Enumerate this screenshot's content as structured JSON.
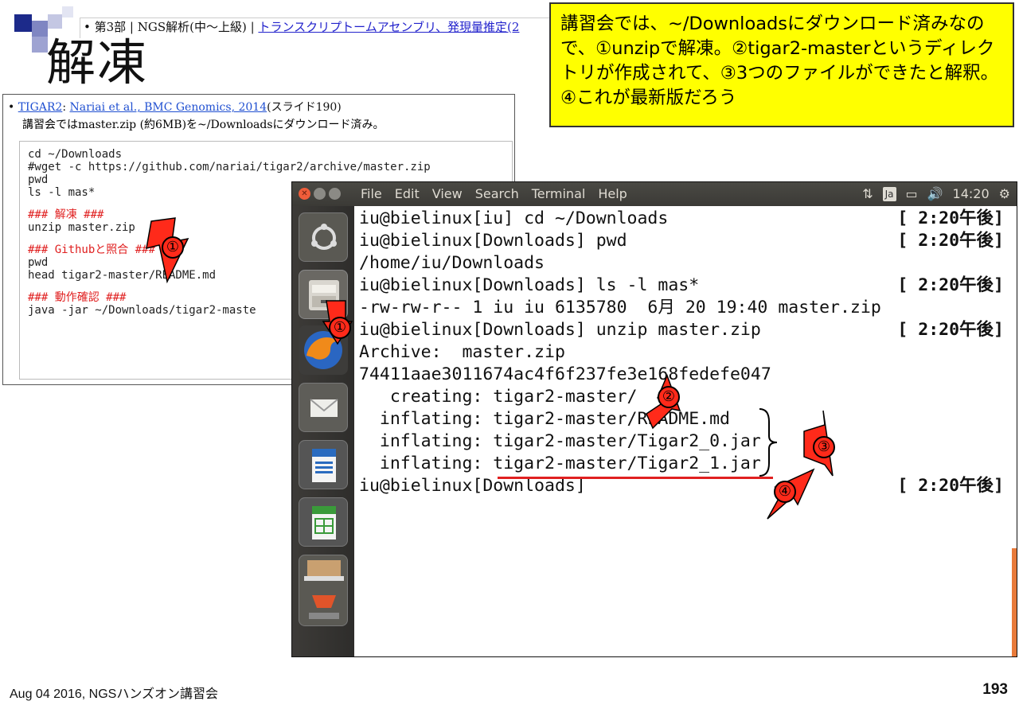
{
  "slide": {
    "breadcrumb_prefix": "• 第3部 | NGS解析(中～上級) | ",
    "breadcrumb_link": "トランスクリプトームアセンブリ、発現量推定(2",
    "title": "解凍",
    "footer": "Aug 04 2016, NGSハンズオン講習会",
    "page_number": "193"
  },
  "callout": {
    "text": "講習会では、~/Downloadsにダウンロード済みなので、①unzipで解凍。②tigar2-masterというディレクトリが作成されて、③3つのファイルができたと解釈。④これが最新版だろう"
  },
  "doc": {
    "bullet_link1": "TIGAR2",
    "bullet_sep": ": ",
    "bullet_link2": "Nariai et al., BMC Genomics, 2014",
    "bullet_tail": "(スライド190)",
    "note": "講習会ではmaster.zip (約6MB)を~/Downloadsにダウンロード済み。",
    "code": [
      "cd ~/Downloads",
      "#wget -c https://github.com/nariai/tigar2/archive/master.zip",
      "pwd",
      "ls -l mas*",
      "### 解凍 ###",
      "unzip master.zip",
      "### Githubと照合 ###",
      "pwd",
      "head tigar2-master/README.md",
      "### 動作確認 ###",
      "java -jar ~/Downloads/tigar2-maste"
    ]
  },
  "terminal": {
    "menu": [
      "File",
      "Edit",
      "View",
      "Search",
      "Terminal",
      "Help"
    ],
    "tray": {
      "lang": "Ja",
      "time": "14:20"
    },
    "lines": [
      {
        "text": "iu@bielinux[iu] cd ~/Downloads",
        "stamp": "[ 2:20午後]"
      },
      {
        "text": "iu@bielinux[Downloads] pwd",
        "stamp": "[ 2:20午後]"
      },
      {
        "text": "/home/iu/Downloads",
        "stamp": ""
      },
      {
        "text": "iu@bielinux[Downloads] ls -l mas*",
        "stamp": "[ 2:20午後]"
      },
      {
        "text": "-rw-rw-r-- 1 iu iu 6135780  6月 20 19:40 master.zip",
        "stamp": ""
      },
      {
        "text": "iu@bielinux[Downloads] unzip master.zip",
        "stamp": "[ 2:20午後]"
      },
      {
        "text": "Archive:  master.zip",
        "stamp": ""
      },
      {
        "text": "74411aae3011674ac4f6f237fe3e168fedefe047",
        "stamp": ""
      },
      {
        "text": "   creating: tigar2-master/",
        "stamp": ""
      },
      {
        "text": "  inflating: tigar2-master/README.md",
        "stamp": ""
      },
      {
        "text": "  inflating: tigar2-master/Tigar2_0.jar",
        "stamp": ""
      },
      {
        "text": "  inflating: tigar2-master/Tigar2_1.jar",
        "stamp": ""
      },
      {
        "text": "iu@bielinux[Downloads]",
        "stamp": "[ 2:20午後]"
      }
    ]
  },
  "markers": [
    "①",
    "①",
    "②",
    "③",
    "④"
  ],
  "colors": {
    "callout_bg": "#ffff00",
    "marker_red": "#ff2a1a",
    "code_comment": "#e02020",
    "link": "#1f4fd1"
  }
}
